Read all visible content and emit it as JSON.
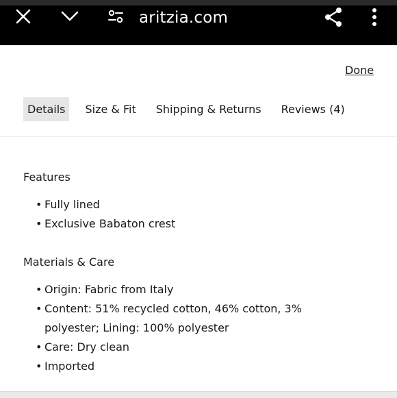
{
  "browser": {
    "url": "aritzia.com",
    "icons": [
      "close-icon",
      "chevron-down-icon",
      "site-settings-icon",
      "share-icon",
      "more-vertical-icon"
    ]
  },
  "panel": {
    "done_label": "Done",
    "tabs": [
      {
        "label": "Details",
        "active": true
      },
      {
        "label": "Size & Fit",
        "active": false
      },
      {
        "label": "Shipping & Returns",
        "active": false
      },
      {
        "label": "Reviews (4)",
        "active": false
      }
    ]
  },
  "details": {
    "features": {
      "title": "Features",
      "items": [
        "Fully lined",
        "Exclusive Babaton crest"
      ]
    },
    "materials": {
      "title": "Materials & Care",
      "items": [
        "Origin: Fabric from Italy",
        "Content: 51% recycled cotton, 46% cotton, 3% polyester; Lining: 100% polyester",
        "Care: Dry clean",
        "Imported"
      ]
    }
  },
  "colors": {
    "bar_background": "#000000",
    "active_tab_background": "#e6e6e6",
    "text": "#1a1a1a"
  }
}
